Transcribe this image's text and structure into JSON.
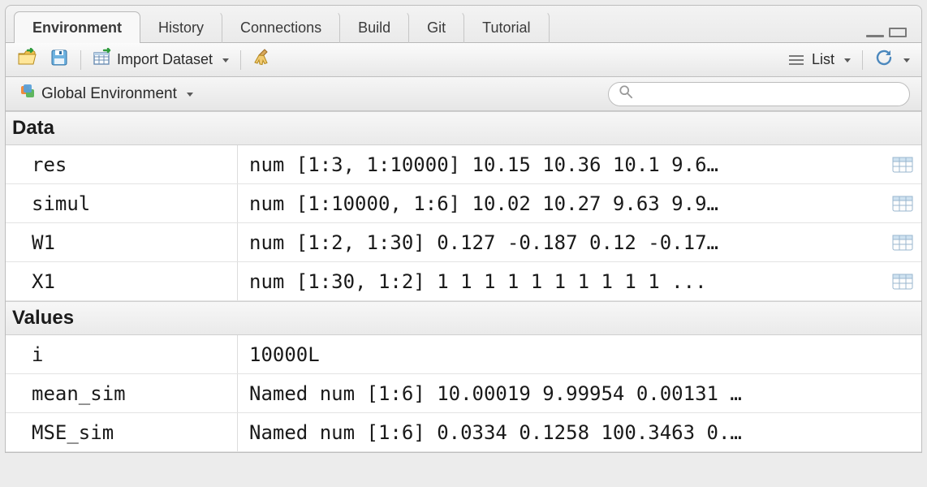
{
  "tabs": [
    {
      "label": "Environment"
    },
    {
      "label": "History"
    },
    {
      "label": "Connections"
    },
    {
      "label": "Build"
    },
    {
      "label": "Git"
    },
    {
      "label": "Tutorial"
    }
  ],
  "active_tab_index": 0,
  "toolbar": {
    "import_label": "Import Dataset",
    "view_mode_label": "List"
  },
  "scope": {
    "label": "Global Environment",
    "search_placeholder": ""
  },
  "sections": [
    {
      "title": "Data",
      "rows": [
        {
          "name": "res",
          "value": "num [1:3, 1:10000] 10.15 10.36 10.1 9.6…",
          "viewable": true
        },
        {
          "name": "simul",
          "value": "num [1:10000, 1:6] 10.02 10.27 9.63 9.9…",
          "viewable": true
        },
        {
          "name": "W1",
          "value": "num [1:2, 1:30] 0.127 -0.187 0.12 -0.17…",
          "viewable": true
        },
        {
          "name": "X1",
          "value": "num [1:30, 1:2] 1 1 1 1 1 1 1 1 1 1 ...",
          "viewable": true
        }
      ]
    },
    {
      "title": "Values",
      "rows": [
        {
          "name": "i",
          "value": "10000L",
          "viewable": false
        },
        {
          "name": "mean_sim",
          "value": "Named num [1:6] 10.00019 9.99954 0.00131 …",
          "viewable": false
        },
        {
          "name": "MSE_sim",
          "value": "Named num [1:6] 0.0334 0.1258 100.3463 0.…",
          "viewable": false
        }
      ]
    }
  ],
  "icons": {
    "folder_open": "folder-open-icon",
    "save": "save-icon",
    "import_table": "import-table-icon",
    "broom": "broom-icon",
    "list_lines": "list-lines-icon",
    "refresh": "refresh-icon",
    "env": "environment-icon",
    "search": "search-icon",
    "grid": "data-grid-icon",
    "minimize": "minimize-icon",
    "maximize": "maximize-icon"
  }
}
